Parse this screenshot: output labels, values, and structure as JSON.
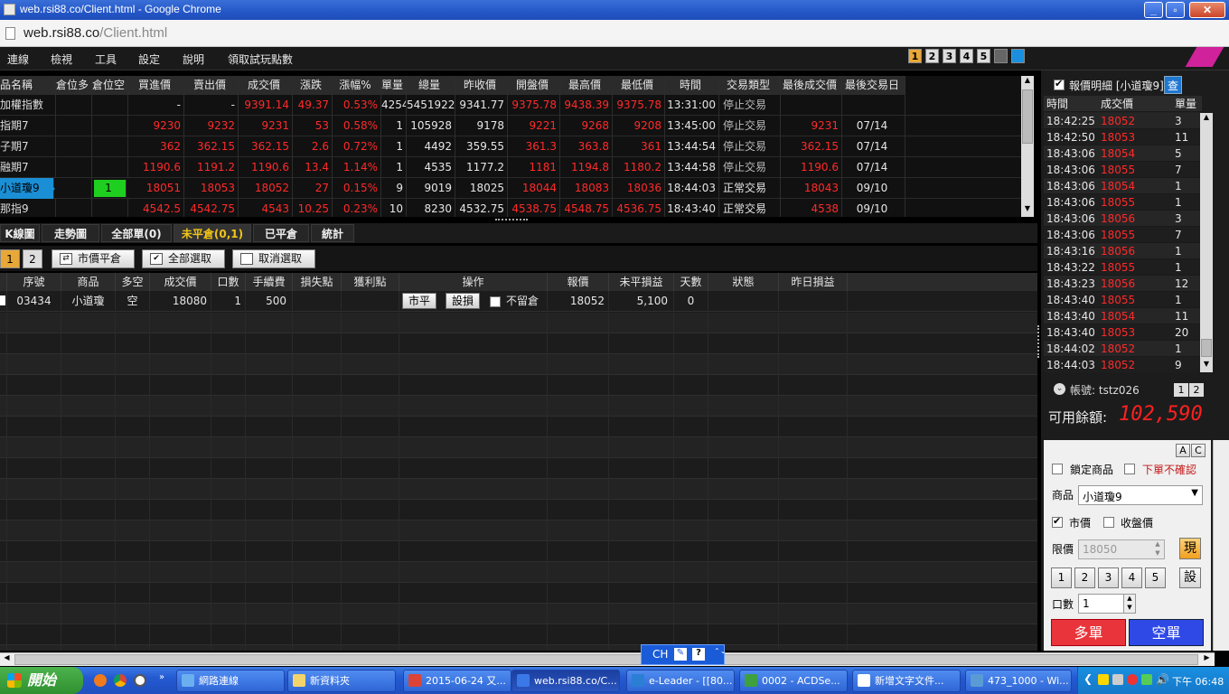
{
  "window": {
    "title": "web.rsi88.co/Client.html - Google Chrome"
  },
  "address": {
    "host": "web.rsi88.co",
    "path": "/Client.html"
  },
  "menu": [
    "連線",
    "檢視",
    "工具",
    "設定",
    "說明",
    "領取試玩點數"
  ],
  "quick_pages": [
    "1",
    "2",
    "3",
    "4",
    "5"
  ],
  "quote_table": {
    "headers": [
      "品名稱",
      "倉位多",
      "倉位空",
      "買進價",
      "賣出價",
      "成交價",
      "漲跌",
      "漲幅%",
      "單量",
      "總量",
      "昨收價",
      "開盤價",
      "最高價",
      "最低價",
      "時間",
      "交易類型",
      "最後成交價",
      "最後交易日"
    ],
    "rows": [
      [
        "加權指數",
        "",
        "",
        "-",
        "-",
        "9391.14",
        "49.37",
        "0.53%",
        "4254",
        "5451922",
        "9341.77",
        "9375.78",
        "9438.39",
        "9375.78",
        "13:31:00",
        "停止交易",
        "",
        ""
      ],
      [
        "指期7",
        "",
        "",
        "9230",
        "9232",
        "9231",
        "53",
        "0.58%",
        "1",
        "105928",
        "9178",
        "9221",
        "9268",
        "9208",
        "13:45:00",
        "停止交易",
        "9231",
        "07/14"
      ],
      [
        "子期7",
        "",
        "",
        "362",
        "362.15",
        "362.15",
        "2.6",
        "0.72%",
        "1",
        "4492",
        "359.55",
        "361.3",
        "363.8",
        "361",
        "13:44:54",
        "停止交易",
        "362.15",
        "07/14"
      ],
      [
        "融期7",
        "",
        "",
        "1190.6",
        "1191.2",
        "1190.6",
        "13.4",
        "1.14%",
        "1",
        "4535",
        "1177.2",
        "1181",
        "1194.8",
        "1180.2",
        "13:44:58",
        "停止交易",
        "1190.6",
        "07/14"
      ],
      [
        "小道瓊9",
        "",
        "1",
        "18051",
        "18053",
        "18052",
        "27",
        "0.15%",
        "9",
        "9019",
        "18025",
        "18044",
        "18083",
        "18036",
        "18:44:03",
        "正常交易",
        "18043",
        "09/10"
      ],
      [
        "那指9",
        "",
        "",
        "4542.5",
        "4542.75",
        "4543",
        "10.25",
        "0.23%",
        "10",
        "8230",
        "4532.75",
        "4538.75",
        "4548.75",
        "4536.75",
        "18:43:40",
        "正常交易",
        "4538",
        "09/10"
      ]
    ]
  },
  "tabs": [
    "K線圖",
    "走勢圖",
    "全部單(0)",
    "未平倉(0,1)",
    "已平倉",
    "統計"
  ],
  "pos_pages": [
    "1",
    "2"
  ],
  "pos_buttons": {
    "market_close": "市價平倉",
    "select_all": "全部選取",
    "deselect": "取消選取"
  },
  "pos_table": {
    "headers": [
      "序號",
      "商品",
      "多空",
      "成交價",
      "口數",
      "手續費",
      "損失點",
      "獲利點",
      "操作",
      "報價",
      "未平損益",
      "天數",
      "狀態",
      "昨日損益"
    ],
    "row": {
      "seq": "03434",
      "product": "小道瓊",
      "side": "空",
      "price": "18080",
      "qty": "1",
      "fee": "500",
      "btn_close": "市平",
      "btn_stop": "設損",
      "keep_label": "不留倉",
      "quote": "18052",
      "pnl": "5,100",
      "days": "0"
    }
  },
  "ticks": {
    "title": "報價明細 [小道瓊9]",
    "query": "查",
    "headers": [
      "時間",
      "成交價",
      "單量"
    ],
    "rows": [
      [
        "18:42:25",
        "18052",
        "3"
      ],
      [
        "18:42:50",
        "18053",
        "11"
      ],
      [
        "18:43:06",
        "18054",
        "5"
      ],
      [
        "18:43:06",
        "18055",
        "7"
      ],
      [
        "18:43:06",
        "18054",
        "1"
      ],
      [
        "18:43:06",
        "18055",
        "1"
      ],
      [
        "18:43:06",
        "18056",
        "3"
      ],
      [
        "18:43:06",
        "18055",
        "7"
      ],
      [
        "18:43:16",
        "18056",
        "1"
      ],
      [
        "18:43:22",
        "18055",
        "1"
      ],
      [
        "18:43:23",
        "18056",
        "12"
      ],
      [
        "18:43:40",
        "18055",
        "1"
      ],
      [
        "18:43:40",
        "18054",
        "11"
      ],
      [
        "18:43:40",
        "18053",
        "20"
      ],
      [
        "18:44:02",
        "18052",
        "1"
      ],
      [
        "18:44:03",
        "18052",
        "9"
      ]
    ]
  },
  "account": {
    "label": "帳號: tstz026",
    "balance_label": "可用餘額:",
    "balance": "102,590",
    "pages": [
      "1",
      "2"
    ]
  },
  "order": {
    "ac": [
      "A",
      "C"
    ],
    "lock_label": "鎖定商品",
    "noconfirm_label": "下單不確認",
    "product_label": "商品",
    "product_value": "小道瓊9",
    "market_label": "市價",
    "close_label": "收盤價",
    "limit_label": "限價",
    "limit_value": "18050",
    "now_btn": "現",
    "qty_presets": [
      "1",
      "2",
      "3",
      "4",
      "5"
    ],
    "set_btn": "設",
    "qty_label": "口數",
    "qty_value": "1",
    "buy": "多單",
    "sell": "空單"
  },
  "ime": {
    "label": "CH"
  },
  "taskbar": {
    "start": "開始",
    "tasks": [
      "網路連線",
      "新資料夾",
      "2015-06-24 又...",
      "web.rsi88.co/C...",
      "e-Leader - [[80...",
      "0002 - ACDSe...",
      "新增文字文件...",
      "473_1000 - Wi..."
    ],
    "clock": "下午 06:48"
  },
  "colors": {
    "up": "#ff2a2a",
    "green": "#22c922",
    "buy": "#e8343a",
    "sell": "#2f49e6",
    "tab_active": "#f0c419"
  }
}
